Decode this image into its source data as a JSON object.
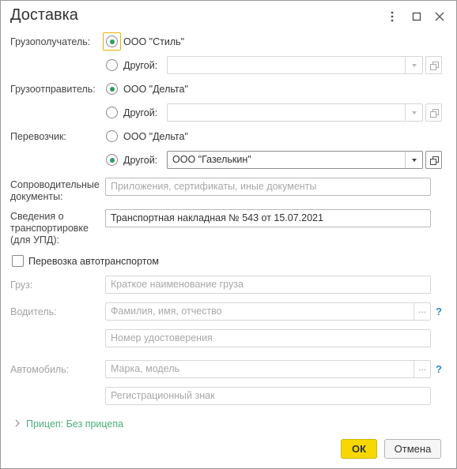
{
  "window": {
    "title": "Доставка",
    "menu_icon": "more-vertical-icon",
    "maximize_icon": "maximize-icon",
    "close_icon": "close-icon"
  },
  "consignee": {
    "label": "Грузополучатель:",
    "option1": "ООО \"Стиль\"",
    "option2": "Другой:",
    "other_value": ""
  },
  "shipper": {
    "label": "Грузоотправитель:",
    "option1": "ООО \"Дельта\"",
    "option2": "Другой:",
    "other_value": ""
  },
  "carrier": {
    "label": "Перевозчик:",
    "option1": "ООО \"Дельта\"",
    "option2": "Другой:",
    "other_value": "ООО \"Газелькин\""
  },
  "docs": {
    "label_line1": "Сопроводительные",
    "label_line2": "документы:",
    "placeholder": "Приложения, сертификаты, иные документы"
  },
  "transport_info": {
    "label_line1": "Сведения о",
    "label_line2": "транспортировке",
    "label_line3": "(для УПД):",
    "value": "Транспортная накладная № 543 от 15.07.2021"
  },
  "auto": {
    "checkbox_label": "Перевозка автотранспортом",
    "checked": false
  },
  "cargo": {
    "label": "Груз:",
    "placeholder": "Краткое наименование груза"
  },
  "driver": {
    "label": "Водитель:",
    "name_placeholder": "Фамилия, имя, отчество",
    "license_placeholder": "Номер удостоверения",
    "help": "?",
    "dots": "..."
  },
  "vehicle": {
    "label": "Автомобиль:",
    "model_placeholder": "Марка, модель",
    "plate_placeholder": "Регистрационный знак",
    "help": "?",
    "dots": "..."
  },
  "trailer": {
    "text": "Прицеп: Без прицепа"
  },
  "buttons": {
    "ok": "ОК",
    "cancel": "Отмена"
  },
  "colors": {
    "accent_green": "#2e9b63",
    "ok_yellow": "#f6d800",
    "focus_orange": "#f0b000",
    "help_blue": "#2a8ad0"
  }
}
